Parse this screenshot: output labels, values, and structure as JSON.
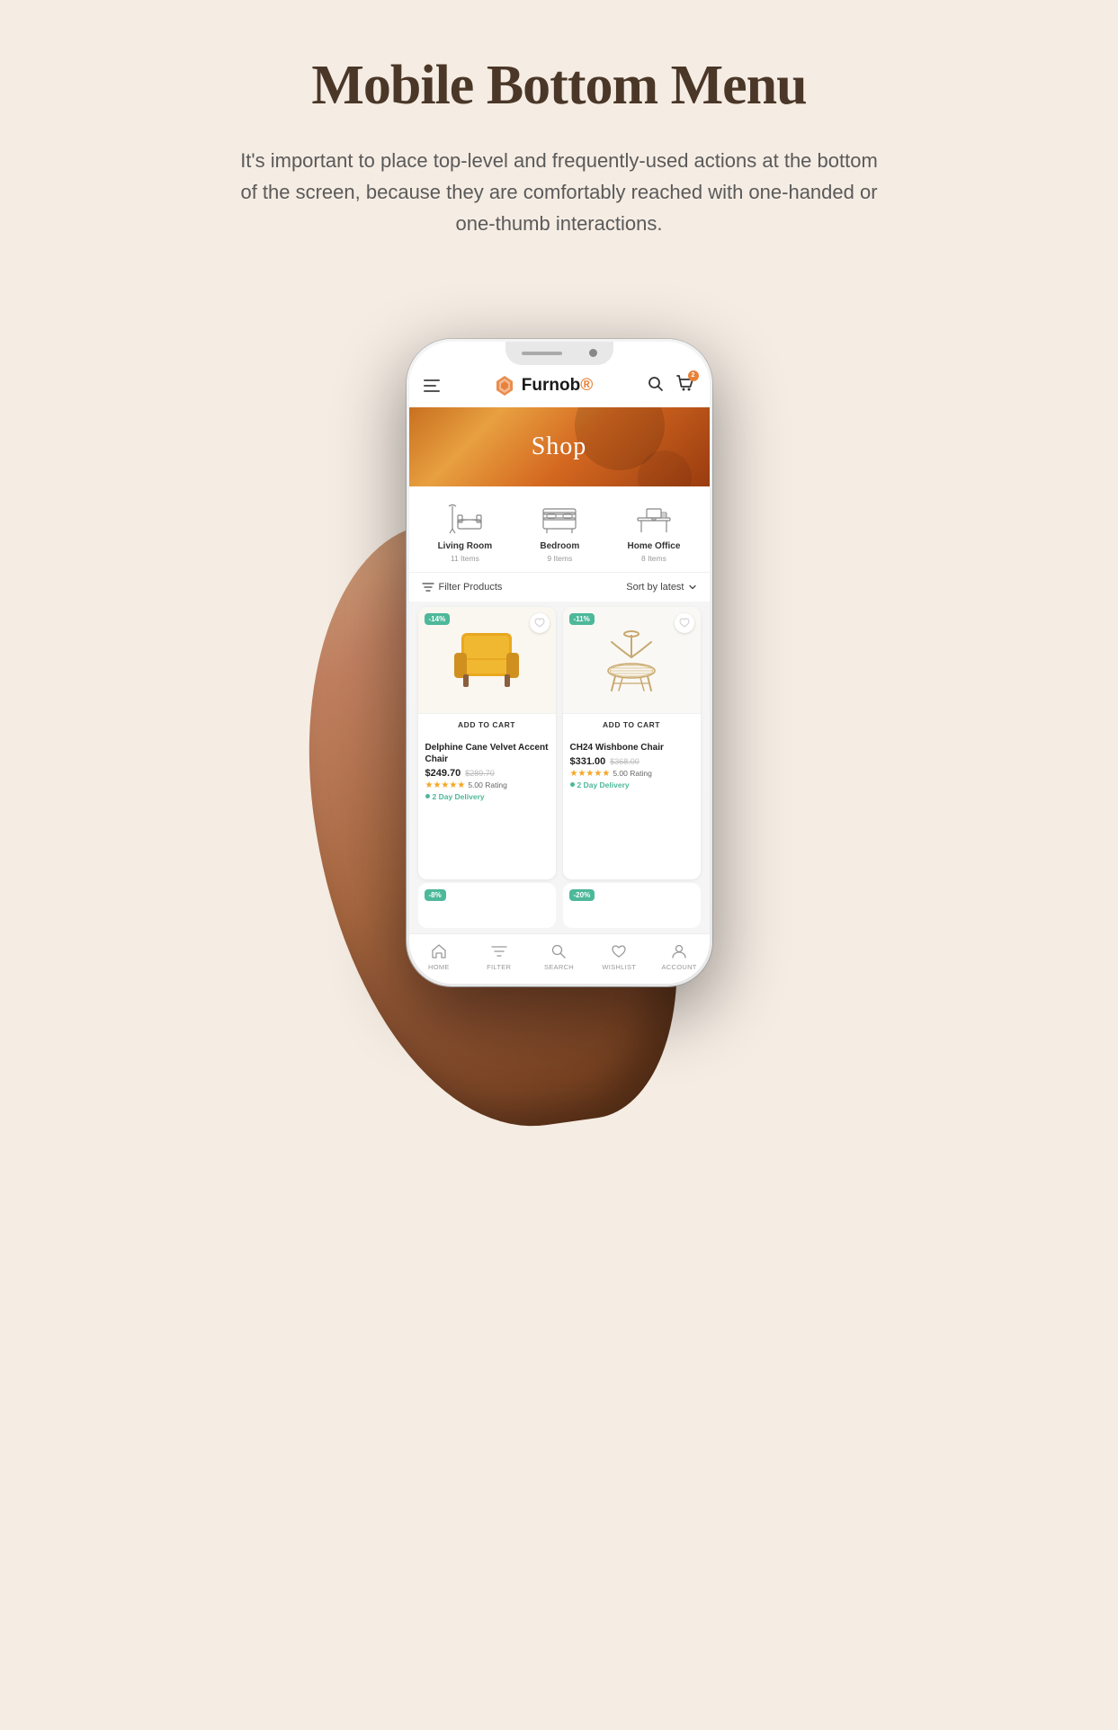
{
  "page": {
    "title": "Mobile Bottom Menu",
    "subtitle": "It's important to place top-level and frequently-used actions at the bottom of the screen, because they are comfortably reached with one-handed or one-thumb interactions."
  },
  "app": {
    "name": "Furnob",
    "trademark": "®",
    "header": {
      "menu_label": "menu",
      "search_label": "search",
      "cart_label": "cart",
      "cart_count": "2"
    },
    "banner": {
      "title": "Shop"
    },
    "categories": [
      {
        "name": "Living Room",
        "count": "11 Items"
      },
      {
        "name": "Bedroom",
        "count": "9 Items"
      },
      {
        "name": "Home Office",
        "count": "8 Items"
      }
    ],
    "filter": {
      "label": "Filter Products",
      "sort_label": "Sort by latest"
    },
    "products": [
      {
        "name": "Delphine Cane Velvet Accent Chair",
        "discount": "-14%",
        "price": "$249.70",
        "old_price": "$289.70",
        "rating": "5.00",
        "rating_label": "5.00 Rating",
        "delivery": "2 Day Delivery",
        "add_to_cart": "ADD TO CART",
        "color": "yellow"
      },
      {
        "name": "CH24 Wishbone Chair",
        "discount": "-11%",
        "price": "$331.00",
        "old_price": "$368.00",
        "rating": "5.00",
        "rating_label": "5.00 Rating",
        "delivery": "2 Day Delivery",
        "add_to_cart": "ADD TO CART",
        "color": "wood"
      }
    ],
    "partial_products": [
      {
        "discount": "-8%"
      },
      {
        "discount": "-20%"
      }
    ],
    "bottom_nav": [
      {
        "label": "HOME",
        "icon": "home-icon"
      },
      {
        "label": "FILTER",
        "icon": "filter-icon"
      },
      {
        "label": "SEARCH",
        "icon": "search-icon"
      },
      {
        "label": "WISHLIST",
        "icon": "heart-icon"
      },
      {
        "label": "ACCOUNT",
        "icon": "account-icon"
      }
    ]
  }
}
